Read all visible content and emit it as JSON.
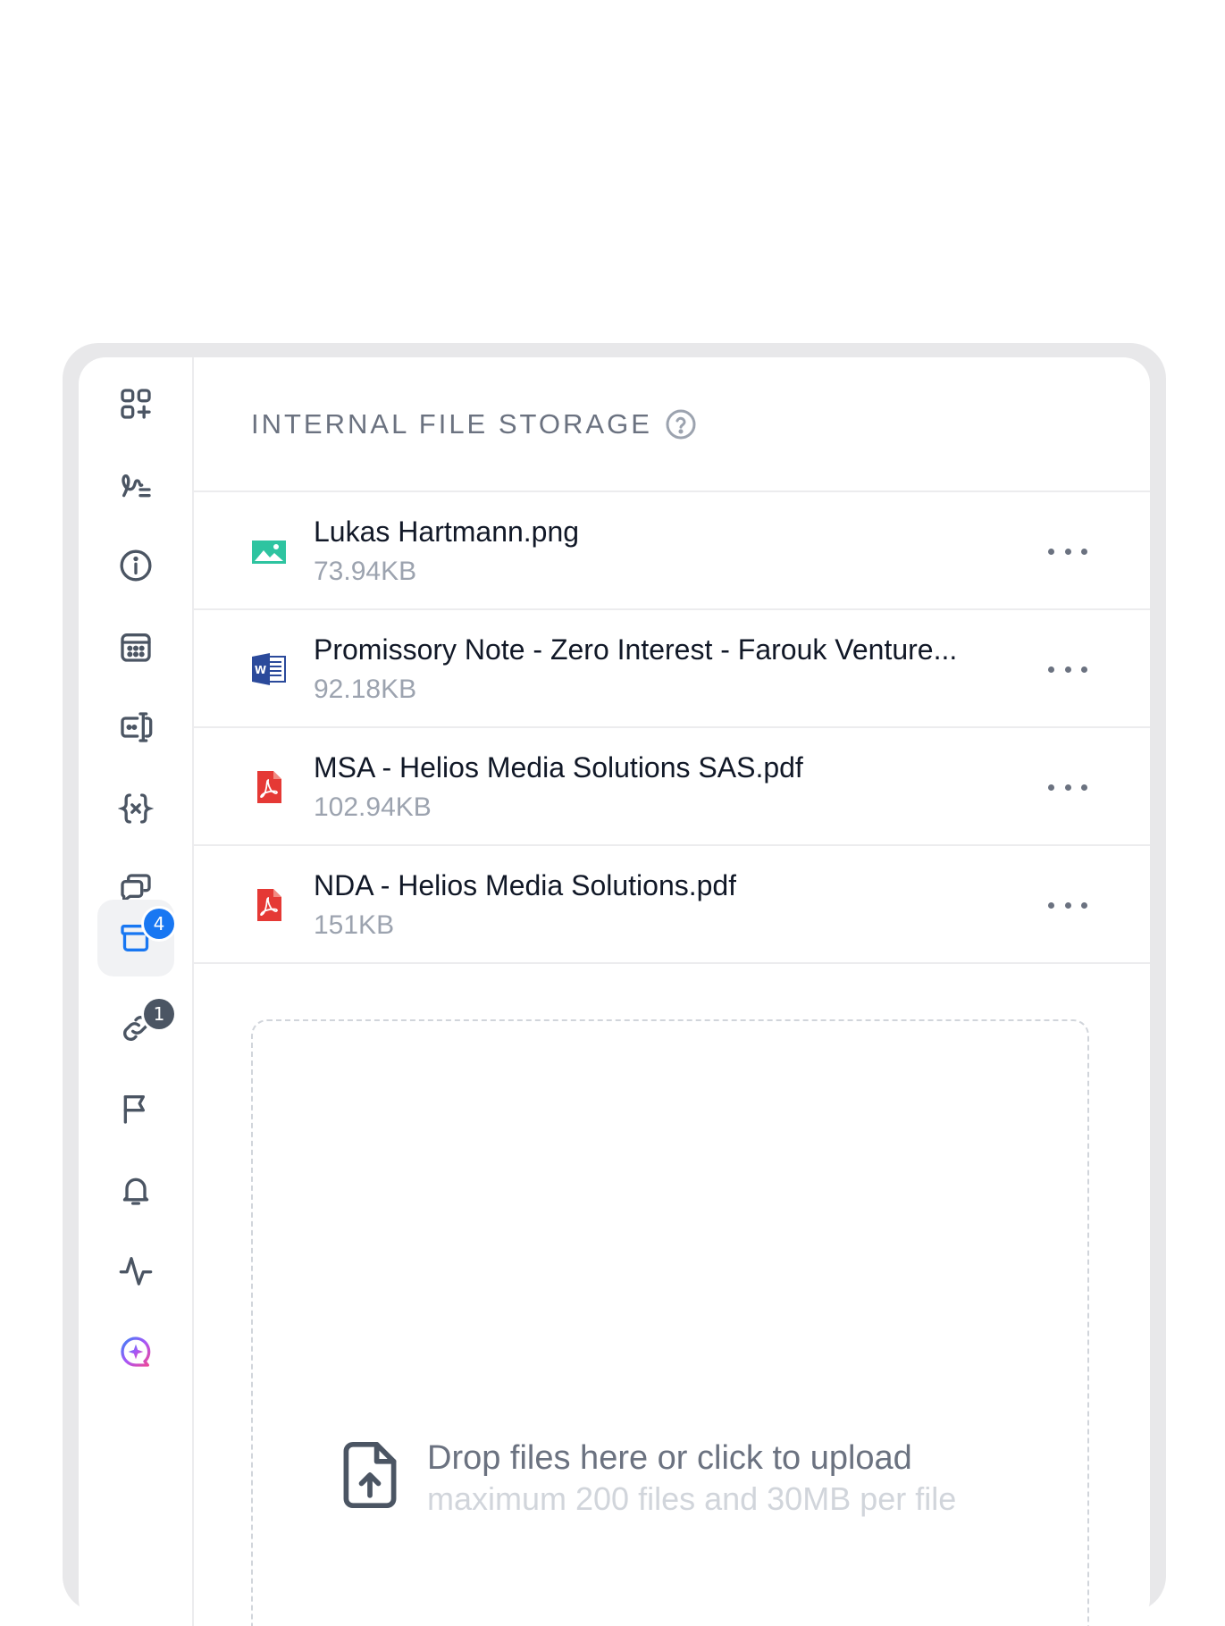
{
  "sidebar": {
    "items": [
      {
        "icon": "apps-add-icon"
      },
      {
        "icon": "signature-icon"
      },
      {
        "icon": "info-icon"
      },
      {
        "icon": "calendar-icon"
      },
      {
        "icon": "input-field-icon"
      },
      {
        "icon": "variable-icon"
      },
      {
        "icon": "comments-icon"
      },
      {
        "icon": "archive-icon",
        "active": true,
        "badge": "4"
      },
      {
        "icon": "link-icon",
        "badge": "1"
      },
      {
        "icon": "flag-icon"
      },
      {
        "icon": "bell-icon"
      },
      {
        "icon": "activity-icon"
      },
      {
        "icon": "ai-assistant-icon"
      }
    ]
  },
  "header": {
    "title": "INTERNAL FILE STORAGE",
    "help_icon": "question-circle-icon"
  },
  "files": [
    {
      "name": "Lukas Hartmann.png",
      "size": "73.94KB",
      "type": "image",
      "icon": "image-file-icon"
    },
    {
      "name": "Promissory Note - Zero Interest - Farouk Venture...",
      "size": "92.18KB",
      "type": "word",
      "icon": "word-file-icon"
    },
    {
      "name": "MSA - Helios Media Solutions SAS.pdf",
      "size": "102.94KB",
      "type": "pdf",
      "icon": "pdf-file-icon"
    },
    {
      "name": "NDA - Helios Media Solutions.pdf",
      "size": "151KB",
      "type": "pdf",
      "icon": "pdf-file-icon"
    }
  ],
  "dropzone": {
    "title": "Drop files here or click to upload",
    "subtitle": "maximum 200 files and 30MB per file",
    "icon": "file-upload-icon"
  },
  "colors": {
    "accent": "#1877f2",
    "image_icon": "#2ec4a0",
    "word_icon": "#2b4a9b",
    "pdf_icon": "#e53935"
  }
}
